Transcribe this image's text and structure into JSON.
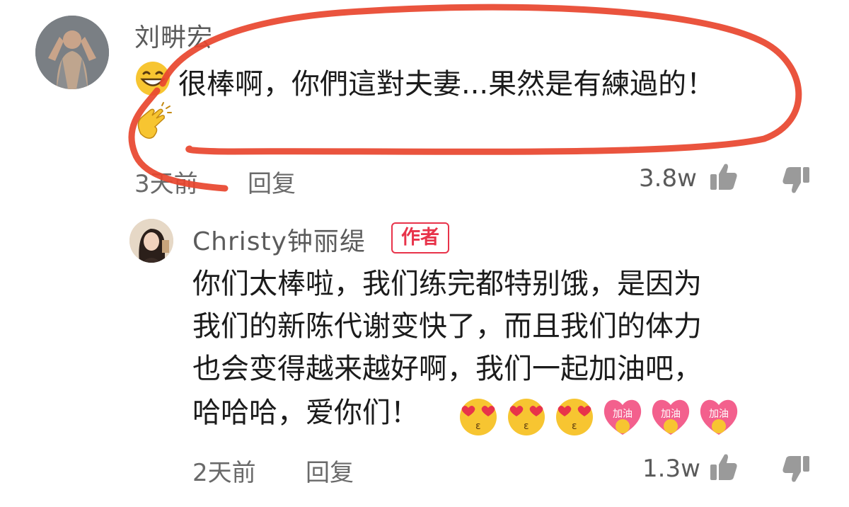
{
  "comments": [
    {
      "username": "刘畊宏",
      "text": "很棒啊，你們這對夫妻...果然是有練過的！",
      "time": "3天前",
      "reply_label": "回复",
      "likes": "3.8w"
    },
    {
      "username": "Christy钟丽缇",
      "author_badge": "作者",
      "lines": [
        "你们太棒啦，我们练完都特别饿，是因为",
        "我们的新陈代谢变快了，而且我们的体力",
        "也会变得越来越好啊，我们一起加油吧，",
        "哈哈哈，爱你们！"
      ],
      "emoji_label": "加油",
      "time": "2天前",
      "reply_label": "回复",
      "likes": "1.3w"
    }
  ],
  "colors": {
    "accent_red": "#e8334a",
    "annotation_red": "#e8452e",
    "text_secondary": "#6a6a6a"
  }
}
